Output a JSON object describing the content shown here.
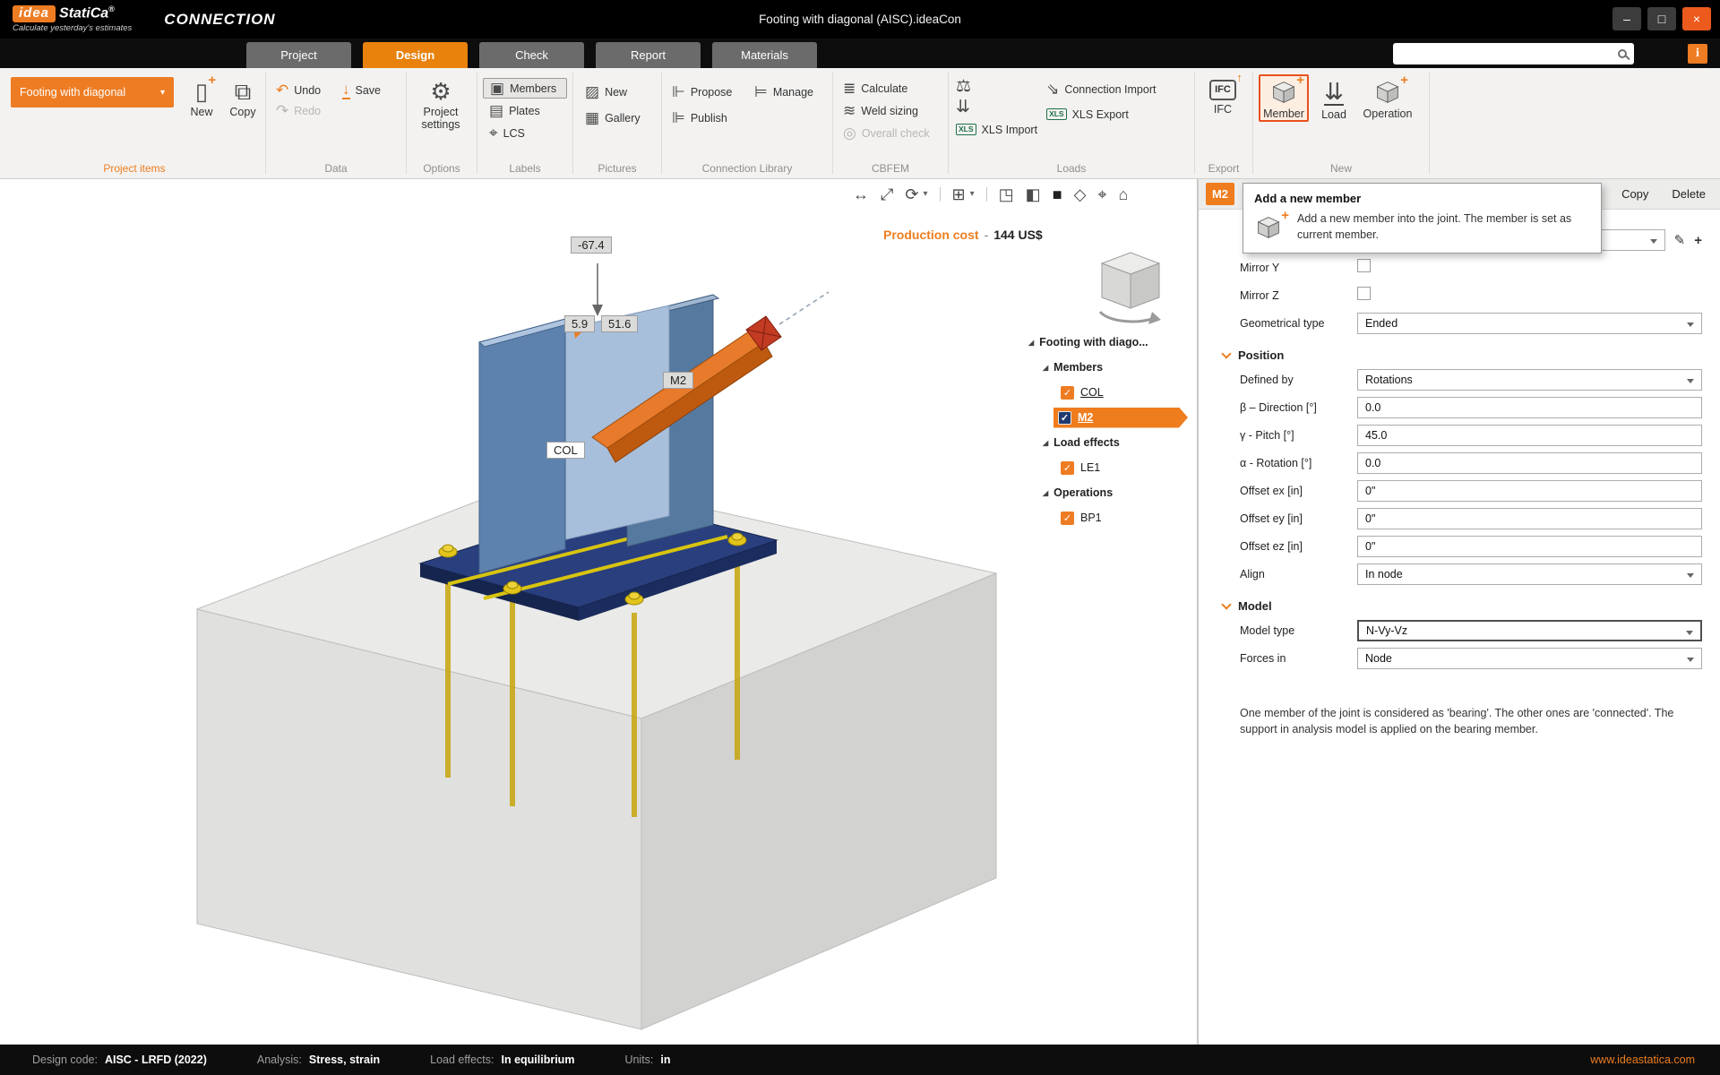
{
  "titlebar": {
    "logo_box": "idea",
    "logo_text": "StatiCa",
    "logo_reg": "®",
    "tagline": "Calculate yesterday's estimates",
    "app_name": "CONNECTION",
    "document_title": "Footing with diagonal (AISC).ideaCon",
    "minimize": "–",
    "maximize": "□",
    "close": "×",
    "info": "i"
  },
  "tabs": {
    "project": "Project",
    "design": "Design",
    "check": "Check",
    "report": "Report",
    "materials": "Materials"
  },
  "ribbon": {
    "project_items": {
      "group_label": "Project items",
      "project_selector": "Footing with diagonal",
      "new": "New",
      "copy": "Copy"
    },
    "data": {
      "group_label": "Data",
      "undo": "Undo",
      "save": "Save",
      "redo": "Redo"
    },
    "options": {
      "group_label": "Options",
      "project_settings": "Project settings"
    },
    "labels": {
      "group_label": "Labels",
      "members": "Members",
      "plates": "Plates",
      "lcs": "LCS"
    },
    "pictures": {
      "group_label": "Pictures",
      "new": "New",
      "gallery": "Gallery"
    },
    "connection_library": {
      "group_label": "Connection Library",
      "propose": "Propose",
      "manage": "Manage",
      "publish": "Publish"
    },
    "cbfem": {
      "group_label": "CBFEM",
      "calculate": "Calculate",
      "weld_sizing": "Weld sizing",
      "overall_check": "Overall check"
    },
    "loads": {
      "group_label": "Loads",
      "connection_import": "Connection Import",
      "xls_export": "XLS Export",
      "xls_import": "XLS Import"
    },
    "export": {
      "group_label": "Export",
      "ifc": "IFC"
    },
    "new": {
      "group_label": "New",
      "member": "Member",
      "load": "Load",
      "operation": "Operation"
    }
  },
  "icons": {
    "page": "▯",
    "copy": "⧉",
    "undo": "↶",
    "redo": "↷",
    "save": "↓",
    "gear": "⚙",
    "tag_members": "▣",
    "tag_plates": "▤",
    "tag_lcs": "⌖",
    "picture_new": "▨",
    "picture_gallery": "▦",
    "propose": "⊩",
    "manage": "⊨",
    "publish": "⊫",
    "calculate": "≣",
    "weld": "≋",
    "overall": "◎",
    "balance": "⚖",
    "load_diagram": "⇊",
    "xls": "XLS",
    "import": "⇘",
    "ifc": "IFC",
    "up_arrow": "↑",
    "member_load": "⇊",
    "check": "✓",
    "pencil": "✎",
    "plus": "+",
    "expander": "◢",
    "vp_measure": "↔",
    "vp_fit": "⤢",
    "vp_rotate": "⟳",
    "chevron_down": "▾",
    "vp_clip": "⊞",
    "vp_view_wire": "◳",
    "vp_view_half": "◧",
    "vp_view_solid": "■",
    "vp_plane": "◇",
    "vp_target": "⌖",
    "vp_home": "⌂",
    "dropdown": "▾"
  },
  "viewport": {
    "production_cost_label": "Production cost",
    "production_cost_sep": "-",
    "production_cost_value": "144 US$",
    "dim_top": "-67.4",
    "dim_a": "5.9",
    "dim_b": "51.6",
    "label_m2": "M2",
    "label_col": "COL"
  },
  "tree": {
    "root": "Footing with diago...",
    "members_header": "Members",
    "col": "COL",
    "m2": "M2",
    "load_effects_header": "Load effects",
    "le1": "LE1",
    "operations_header": "Operations",
    "bp1": "BP1"
  },
  "tooltip": {
    "title": "Add a new member",
    "body": "Add a new member into the joint. The member is set as current member."
  },
  "properties": {
    "member_badge": "M2",
    "copy": "Copy",
    "delete": "Delete",
    "mirror_y": "Mirror Y",
    "mirror_z": "Mirror Z",
    "geometrical_type_label": "Geometrical type",
    "geometrical_type_value": "Ended",
    "position_section": "Position",
    "defined_by_label": "Defined by",
    "defined_by_value": "Rotations",
    "beta_label": "β – Direction [°]",
    "beta_value": "0.0",
    "gamma_label": "γ - Pitch [°]",
    "gamma_value": "45.0",
    "alpha_label": "α - Rotation [°]",
    "alpha_value": "0.0",
    "offset_ex_label": "Offset ex [in]",
    "offset_ex_value": "0\"",
    "offset_ey_label": "Offset ey [in]",
    "offset_ey_value": "0\"",
    "offset_ez_label": "Offset ez [in]",
    "offset_ez_value": "0\"",
    "align_label": "Align",
    "align_value": "In node",
    "model_section": "Model",
    "model_type_label": "Model type",
    "model_type_value": "N-Vy-Vz",
    "forces_in_label": "Forces in",
    "forces_in_value": "Node",
    "note": "One member of the joint is considered as 'bearing'. The other ones are 'connected'. The support in analysis model is applied on the bearing member."
  },
  "statusbar": {
    "design_code_label": "Design code:",
    "design_code_value": "AISC - LRFD (2022)",
    "analysis_label": "Analysis:",
    "analysis_value": "Stress, strain",
    "load_effects_label": "Load effects:",
    "load_effects_value": "In equilibrium",
    "units_label": "Units:",
    "units_value": "in",
    "website": "www.ideastatica.com"
  }
}
